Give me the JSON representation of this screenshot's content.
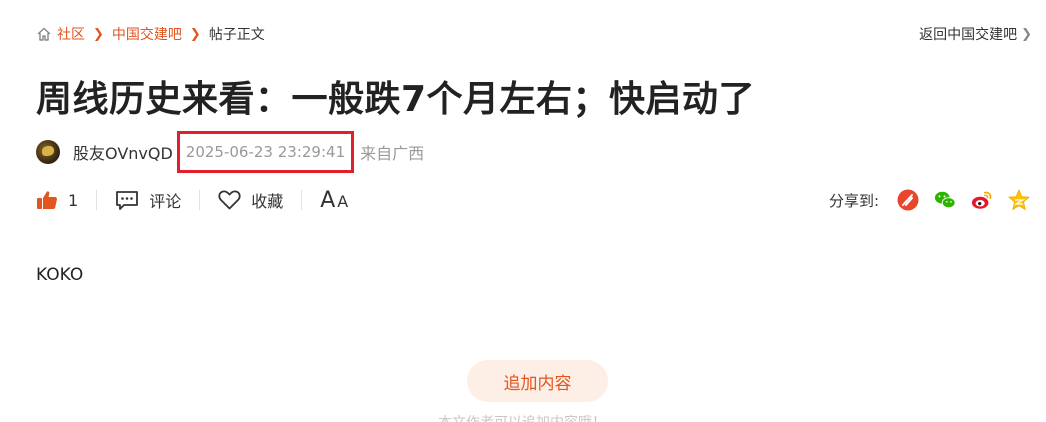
{
  "breadcrumb": {
    "items": [
      {
        "label": "社区"
      },
      {
        "label": "中国交建吧"
      }
    ],
    "current": "帖子正文"
  },
  "back_link": "返回中国交建吧",
  "post": {
    "title": "周线历史来看：一般跌7个月左右；快启动了",
    "author": "股友OVnvQD",
    "time": "2025-06-23 23:29:41",
    "location": "来自广西",
    "content": "KOKO"
  },
  "actions": {
    "like_count": "1",
    "comment_label": "评论",
    "collect_label": "收藏",
    "font_big": "A",
    "font_small": "A"
  },
  "share": {
    "label": "分享到:",
    "icons": [
      "tencent-weibo-icon",
      "wechat-icon",
      "sina-weibo-icon",
      "qzone-icon"
    ]
  },
  "append": {
    "button_label": "追加内容",
    "hint": "本文作者可以追加内容哦！"
  },
  "colors": {
    "accent": "#e2551f",
    "highlight_box": "#e0202a",
    "muted": "#999999"
  }
}
